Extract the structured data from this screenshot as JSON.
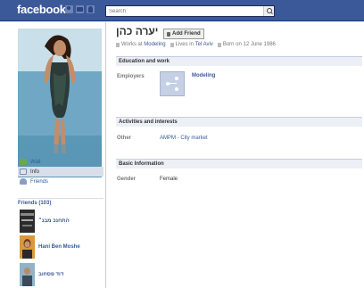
{
  "header": {
    "logo": "facebook",
    "search_placeholder": "Search"
  },
  "sidebar": {
    "nav": [
      {
        "label": "Wall"
      },
      {
        "label": "Info"
      },
      {
        "label": "Friends"
      }
    ],
    "friends_header": "Friends (103)",
    "friends": [
      {
        "name": "התחנכ מבנ״"
      },
      {
        "name": "Hani Ben Moshe"
      },
      {
        "name": "דוד פסחוב"
      }
    ]
  },
  "profile": {
    "name": "יערה כהן",
    "add_friend_label": "Add Friend",
    "facts": {
      "works_prefix": "Works at",
      "works_at": "Modeling",
      "lives_prefix": "Lives in",
      "lives_in": "Tel Aviv",
      "born": "Born on 12 June 1986"
    }
  },
  "sections": {
    "education": {
      "title": "Education and work",
      "label": "Employers",
      "value": "Modeling"
    },
    "activities": {
      "title": "Activities and interests",
      "label": "Other",
      "value": "AMPM - City market"
    },
    "basic": {
      "title": "Basic Information",
      "label": "Gender",
      "value": "Female"
    }
  },
  "colors": {
    "brand": "#3b5998",
    "link": "#3b5998",
    "section_bg": "#eceff5"
  }
}
